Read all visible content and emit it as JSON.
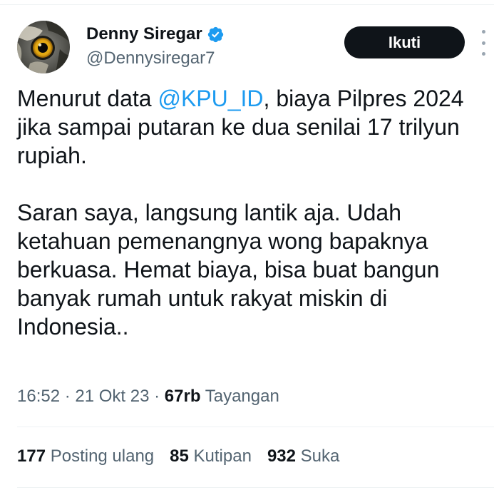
{
  "author": {
    "display_name": "Denny Siregar",
    "handle": "@Dennysiregar7",
    "verified": true,
    "avatar_icon": "owl-avatar"
  },
  "follow_button": {
    "label": "Ikuti"
  },
  "more_menu": {
    "icon": "more-vertical-icon"
  },
  "tweet": {
    "paragraph1_before": "Menurut data ",
    "mention": "@KPU_ID",
    "paragraph1_after": ", biaya Pilpres 2024 jika sampai putaran ke dua senilai 17 trilyun rupiah.",
    "paragraph2": "Saran saya, langsung lantik aja. Udah ketahuan pemenangnya wong bapaknya berkuasa. Hemat biaya, bisa buat bangun banyak rumah untuk rakyat miskin di Indonesia.."
  },
  "meta": {
    "time": "16:52",
    "separator": " · ",
    "date": "21 Okt 23",
    "views_count": "67rb",
    "views_label": " Tayangan"
  },
  "stats": {
    "reposts_count": "177",
    "reposts_label": " Posting ulang",
    "quotes_count": "85",
    "quotes_label": " Kutipan",
    "likes_count": "932",
    "likes_label": " Suka"
  },
  "colors": {
    "text": "#0f1419",
    "secondary": "#536471",
    "link": "#1d9bf0",
    "verified": "#1d9bf0",
    "button_bg": "#0f1419",
    "divider": "#eff3f4"
  }
}
